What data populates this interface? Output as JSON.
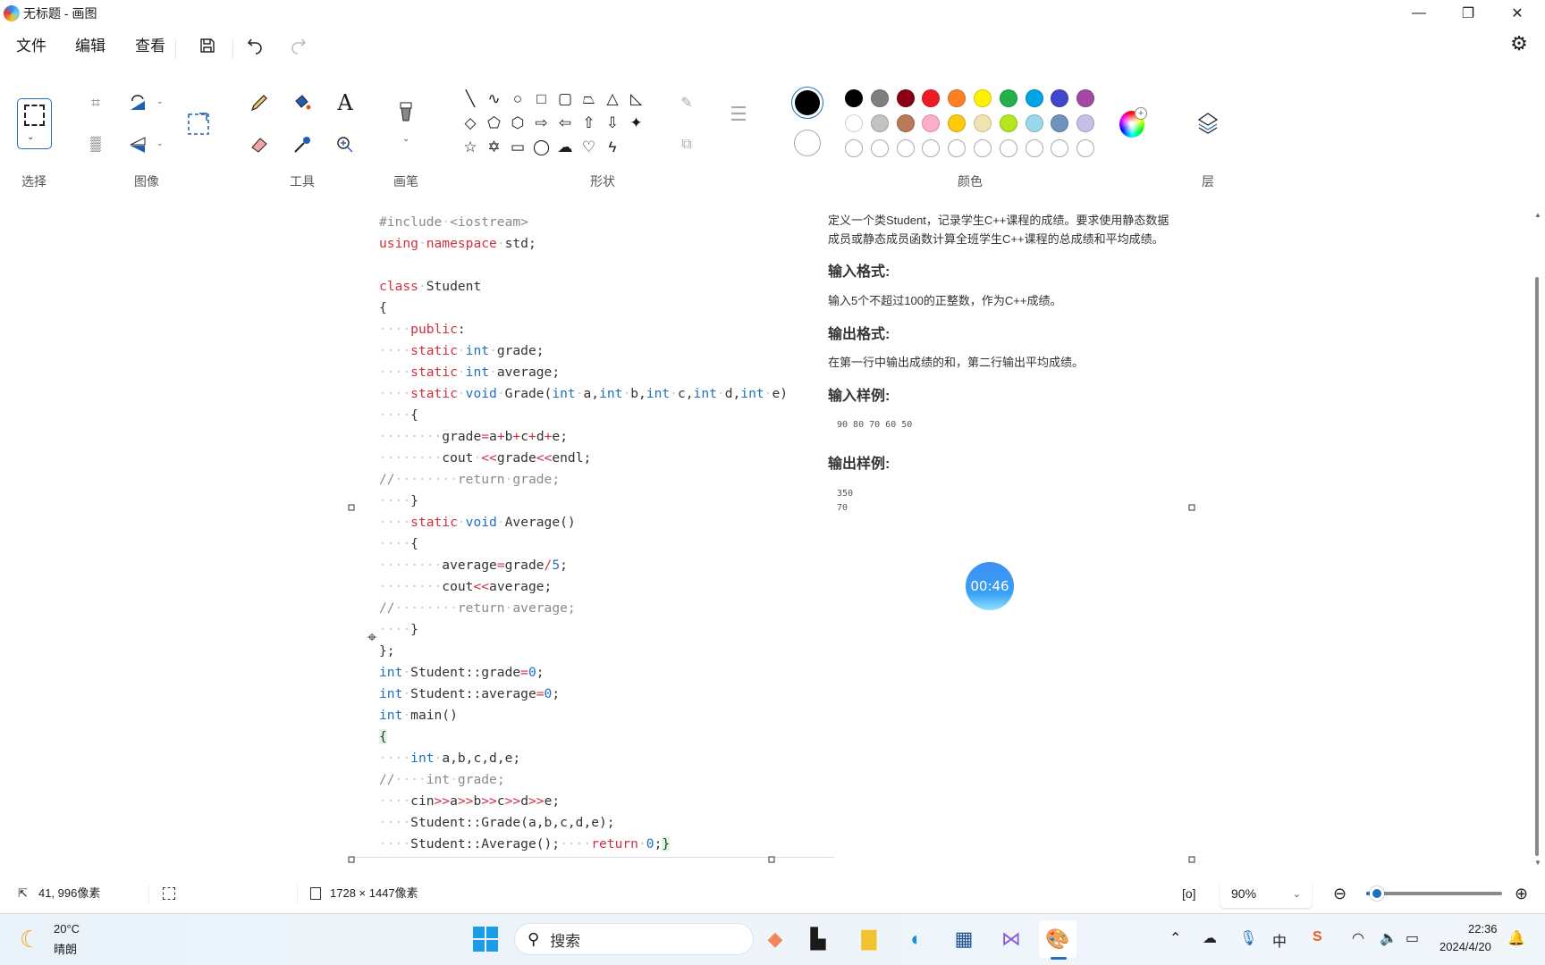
{
  "window": {
    "title": "无标题 - 画图",
    "minimize_icon": "minimize-icon",
    "restore_icon": "restore-icon",
    "close_icon": "close-icon"
  },
  "menu": {
    "file": "文件",
    "edit": "编辑",
    "view": "查看"
  },
  "ribbon": {
    "groups": {
      "select": "选择",
      "image": "图像",
      "tools": "工具",
      "brush": "画笔",
      "shapes": "形状",
      "colors": "颜色",
      "layers": "层"
    },
    "primary_color": "#000000",
    "secondary_color": "#ffffff",
    "palette": [
      [
        "#000000",
        "#7f7f7f",
        "#880015",
        "#ed1c24",
        "#ff7f27",
        "#fff200",
        "#22b14c",
        "#00a2e8",
        "#3f48cc",
        "#a349a4"
      ],
      [
        "#ffffff",
        "#c3c3c3",
        "#b97a57",
        "#ffaec9",
        "#ffc90e",
        "#efe4b0",
        "#b5e61d",
        "#99d9ea",
        "#7092be",
        "#c8bfe7"
      ],
      [
        "",
        "",
        "",
        "",
        "",
        "",
        "",
        "",
        "",
        ""
      ]
    ]
  },
  "canvas": {
    "code_lines": [
      [
        [
          "#include",
          "c"
        ],
        [
          "·",
          "ws"
        ],
        [
          "<iostream>",
          "c"
        ]
      ],
      [
        [
          "using",
          "k"
        ],
        [
          "·",
          "ws"
        ],
        [
          "namespace",
          "k"
        ],
        [
          "·",
          "ws"
        ],
        [
          "std;",
          "p"
        ]
      ],
      [],
      [
        [
          "class",
          "k"
        ],
        [
          "·",
          "ws"
        ],
        [
          "Student",
          "p"
        ]
      ],
      [
        [
          "{",
          "p"
        ]
      ],
      [
        [
          "····",
          "ws"
        ],
        [
          "public",
          "k"
        ],
        [
          ":",
          "p"
        ]
      ],
      [
        [
          "····",
          "ws"
        ],
        [
          "static",
          "k"
        ],
        [
          "·",
          "ws"
        ],
        [
          "int",
          "t"
        ],
        [
          "·",
          "ws"
        ],
        [
          "grade;",
          "p"
        ]
      ],
      [
        [
          "····",
          "ws"
        ],
        [
          "static",
          "k"
        ],
        [
          "·",
          "ws"
        ],
        [
          "int",
          "t"
        ],
        [
          "·",
          "ws"
        ],
        [
          "average;",
          "p"
        ]
      ],
      [
        [
          "····",
          "ws"
        ],
        [
          "static",
          "k"
        ],
        [
          "·",
          "ws"
        ],
        [
          "void",
          "t"
        ],
        [
          "·",
          "ws"
        ],
        [
          "Grade(",
          "p"
        ],
        [
          "int",
          "t"
        ],
        [
          "·",
          "ws"
        ],
        [
          "a,",
          "p"
        ],
        [
          "int",
          "t"
        ],
        [
          "·",
          "ws"
        ],
        [
          "b,",
          "p"
        ],
        [
          "int",
          "t"
        ],
        [
          "·",
          "ws"
        ],
        [
          "c,",
          "p"
        ],
        [
          "int",
          "t"
        ],
        [
          "·",
          "ws"
        ],
        [
          "d,",
          "p"
        ],
        [
          "int",
          "t"
        ],
        [
          "·",
          "ws"
        ],
        [
          "e)",
          "p"
        ]
      ],
      [
        [
          "····",
          "ws"
        ],
        [
          "{",
          "p"
        ]
      ],
      [
        [
          "········",
          "ws"
        ],
        [
          "grade",
          "p"
        ],
        [
          "=",
          "o"
        ],
        [
          "a",
          "p"
        ],
        [
          "+",
          "o"
        ],
        [
          "b",
          "p"
        ],
        [
          "+",
          "o"
        ],
        [
          "c",
          "p"
        ],
        [
          "+",
          "o"
        ],
        [
          "d",
          "p"
        ],
        [
          "+",
          "o"
        ],
        [
          "e;",
          "p"
        ]
      ],
      [
        [
          "········",
          "ws"
        ],
        [
          "cout",
          "p"
        ],
        [
          "·",
          "ws"
        ],
        [
          "<<",
          "o"
        ],
        [
          "grade",
          "p"
        ],
        [
          "<<",
          "o"
        ],
        [
          "endl;",
          "p"
        ]
      ],
      [
        [
          "//",
          "c"
        ],
        [
          "········",
          "ws"
        ],
        [
          "return",
          "c"
        ],
        [
          "·",
          "ws"
        ],
        [
          "grade;",
          "c"
        ]
      ],
      [
        [
          "····",
          "ws"
        ],
        [
          "}",
          "p"
        ]
      ],
      [
        [
          "····",
          "ws"
        ],
        [
          "static",
          "k"
        ],
        [
          "·",
          "ws"
        ],
        [
          "void",
          "t"
        ],
        [
          "·",
          "ws"
        ],
        [
          "Average()",
          "p"
        ]
      ],
      [
        [
          "····",
          "ws"
        ],
        [
          "{",
          "p"
        ]
      ],
      [
        [
          "········",
          "ws"
        ],
        [
          "average",
          "p"
        ],
        [
          "=",
          "o"
        ],
        [
          "grade",
          "p"
        ],
        [
          "/",
          "o"
        ],
        [
          "5",
          "n"
        ],
        [
          ";",
          "p"
        ]
      ],
      [
        [
          "········",
          "ws"
        ],
        [
          "cout",
          "p"
        ],
        [
          "<<",
          "o"
        ],
        [
          "average;",
          "p"
        ]
      ],
      [
        [
          "//",
          "c"
        ],
        [
          "········",
          "ws"
        ],
        [
          "return",
          "c"
        ],
        [
          "·",
          "ws"
        ],
        [
          "average;",
          "c"
        ]
      ],
      [
        [
          "····",
          "ws"
        ],
        [
          "}",
          "p"
        ]
      ],
      [
        [
          "};",
          "p"
        ]
      ],
      [
        [
          "int",
          "t"
        ],
        [
          "·",
          "ws"
        ],
        [
          "Student::grade",
          "p"
        ],
        [
          "=",
          "o"
        ],
        [
          "0",
          "n"
        ],
        [
          ";",
          "p"
        ]
      ],
      [
        [
          "int",
          "t"
        ],
        [
          "·",
          "ws"
        ],
        [
          "Student::average",
          "p"
        ],
        [
          "=",
          "o"
        ],
        [
          "0",
          "n"
        ],
        [
          ";",
          "p"
        ]
      ],
      [
        [
          "int",
          "t"
        ],
        [
          "·",
          "ws"
        ],
        [
          "main()",
          "p"
        ]
      ],
      [
        [
          "{",
          "g"
        ]
      ],
      [
        [
          "····",
          "ws"
        ],
        [
          "int",
          "t"
        ],
        [
          "·",
          "ws"
        ],
        [
          "a,b,c,d,e;",
          "p"
        ]
      ],
      [
        [
          "//",
          "c"
        ],
        [
          "····",
          "ws"
        ],
        [
          "int",
          "c"
        ],
        [
          "·",
          "ws"
        ],
        [
          "grade;",
          "c"
        ]
      ],
      [
        [
          "····",
          "ws"
        ],
        [
          "cin",
          "p"
        ],
        [
          ">>",
          "o"
        ],
        [
          "a",
          "p"
        ],
        [
          ">>",
          "o"
        ],
        [
          "b",
          "p"
        ],
        [
          ">>",
          "o"
        ],
        [
          "c",
          "p"
        ],
        [
          ">>",
          "o"
        ],
        [
          "d",
          "p"
        ],
        [
          ">>",
          "o"
        ],
        [
          "e;",
          "p"
        ]
      ],
      [
        [
          "····",
          "ws"
        ],
        [
          "Student::Grade(a,b,c,d,e);",
          "p"
        ]
      ],
      [
        [
          "····",
          "ws"
        ],
        [
          "Student::Average();",
          "p"
        ],
        [
          "····",
          "ws"
        ],
        [
          "return",
          "k"
        ],
        [
          "·",
          "ws"
        ],
        [
          "0",
          "n"
        ],
        [
          ";",
          "p"
        ],
        [
          "}",
          "g"
        ]
      ]
    ],
    "problem": {
      "desc_line1": "定义一个类Student，记录学生C++课程的成绩。要求使用静态数据",
      "desc_line2": "成员或静态成员函数计算全班学生C++课程的总成绩和平均成绩。",
      "input_format_title": "输入格式:",
      "input_format": "输入5个不超过100的正整数，作为C++成绩。",
      "output_format_title": "输出格式:",
      "output_format": "在第一行中输出成绩的和，第二行输出平均成绩。",
      "sample_input_title": "输入样例:",
      "sample_input": "90 80 70 60 50",
      "sample_output_title": "输出样例:",
      "sample_output_line1": "350",
      "sample_output_line2": "70"
    },
    "timer": "00:46"
  },
  "statusbar": {
    "cursor_position": "41, 996像素",
    "canvas_size": "1728 × 1447像素",
    "zoom_value": "90%",
    "zoom_slider_percent": 8
  },
  "taskbar": {
    "weather_temp": "20°C",
    "weather_desc": "晴朗",
    "search_placeholder": "搜索",
    "time": "22:36",
    "date": "2024/4/20",
    "ime": "中"
  }
}
